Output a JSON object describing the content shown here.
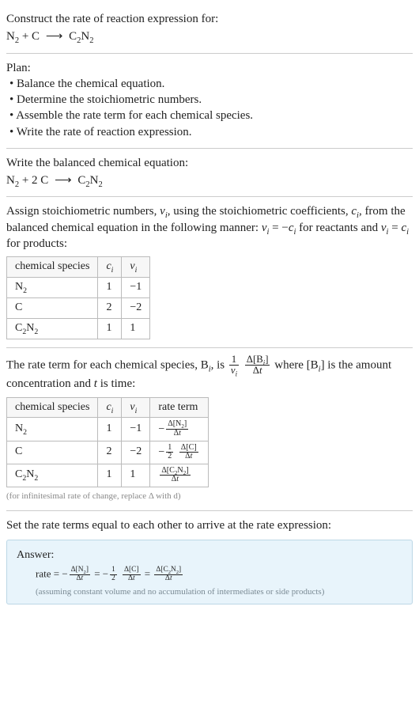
{
  "intro": {
    "prompt": "Construct the rate of reaction expression for:",
    "equation_unbalanced": {
      "lhs": [
        {
          "formula_html": "N<span class=\"sub\">2</span>",
          "coef": ""
        },
        {
          "formula_html": "C",
          "coef": ""
        }
      ],
      "rhs": [
        {
          "formula_html": "C<span class=\"sub\">2</span>N<span class=\"sub\">2</span>",
          "coef": ""
        }
      ]
    }
  },
  "plan": {
    "heading": "Plan:",
    "steps": [
      "Balance the chemical equation.",
      "Determine the stoichiometric numbers.",
      "Assemble the rate term for each chemical species.",
      "Write the rate of reaction expression."
    ]
  },
  "balanced": {
    "heading": "Write the balanced chemical equation:",
    "equation": {
      "lhs": [
        {
          "formula_html": "N<span class=\"sub\">2</span>",
          "coef": ""
        },
        {
          "formula_html": "C",
          "coef": "2"
        }
      ],
      "rhs": [
        {
          "formula_html": "C<span class=\"sub\">2</span>N<span class=\"sub\">2</span>",
          "coef": ""
        }
      ]
    }
  },
  "assign": {
    "text_parts": {
      "a": "Assign stoichiometric numbers, ",
      "nu_i": "ν",
      "b": ", using the stoichiometric coefficients, ",
      "c_i": "c",
      "c": ", from the balanced chemical equation in the following manner: ",
      "rel_react": " = −",
      "d": " for reactants and ",
      "rel_prod": " = ",
      "e": " for products:"
    },
    "table": {
      "headers": [
        "chemical species",
        "c_i",
        "ν_i"
      ],
      "rows": [
        {
          "species_html": "N<span class=\"sub\">2</span>",
          "c": "1",
          "nu": "−1"
        },
        {
          "species_html": "C",
          "c": "2",
          "nu": "−2"
        },
        {
          "species_html": "C<span class=\"sub\">2</span>N<span class=\"sub\">2</span>",
          "c": "1",
          "nu": "1"
        }
      ]
    }
  },
  "rateterm": {
    "text_parts": {
      "a": "The rate term for each chemical species, B",
      "b": ", is ",
      "c": " where [B",
      "d": "] is the amount concentration and ",
      "e": " is time:"
    },
    "t_var": "t",
    "table": {
      "headers": [
        "chemical species",
        "c_i",
        "ν_i",
        "rate term"
      ],
      "rows": [
        {
          "species_html": "N<span class=\"sub\">2</span>",
          "c": "1",
          "nu": "−1",
          "rate_html": "−<span class=\"frac small\"><span class=\"num\">Δ[N<span class=\"sub\">2</span>]</span><span class=\"den\">Δ<span class=\"it\">t</span></span></span>"
        },
        {
          "species_html": "C",
          "c": "2",
          "nu": "−2",
          "rate_html": "−<span class=\"frac small\"><span class=\"num\">1</span><span class=\"den\">2</span></span> <span class=\"frac small\"><span class=\"num\">Δ[C]</span><span class=\"den\">Δ<span class=\"it\">t</span></span></span>"
        },
        {
          "species_html": "C<span class=\"sub\">2</span>N<span class=\"sub\">2</span>",
          "c": "1",
          "nu": "1",
          "rate_html": "<span class=\"frac small\"><span class=\"num\">Δ[C<span class=\"sub\">2</span>N<span class=\"sub\">2</span>]</span><span class=\"den\">Δ<span class=\"it\">t</span></span></span>"
        }
      ]
    },
    "caption": "(for infinitesimal rate of change, replace Δ with d)"
  },
  "conclude": {
    "heading": "Set the rate terms equal to each other to arrive at the rate expression:"
  },
  "answer": {
    "label": "Answer:",
    "rate_word": "rate",
    "terms_html": [
      "−<span class=\"frac small\"><span class=\"num\">Δ[N<span class=\"sub\">2</span>]</span><span class=\"den\">Δ<span class=\"it\">t</span></span></span>",
      "−<span class=\"frac small\"><span class=\"num\">1</span><span class=\"den\">2</span></span> <span class=\"frac small\"><span class=\"num\">Δ[C]</span><span class=\"den\">Δ<span class=\"it\">t</span></span></span>",
      "<span class=\"frac small\"><span class=\"num\">Δ[C<span class=\"sub\">2</span>N<span class=\"sub\">2</span>]</span><span class=\"den\">Δ<span class=\"it\">t</span></span></span>"
    ],
    "assumption": "(assuming constant volume and no accumulation of intermediates or side products)"
  },
  "glyphs": {
    "arrow": "⟶",
    "minus": "−"
  }
}
